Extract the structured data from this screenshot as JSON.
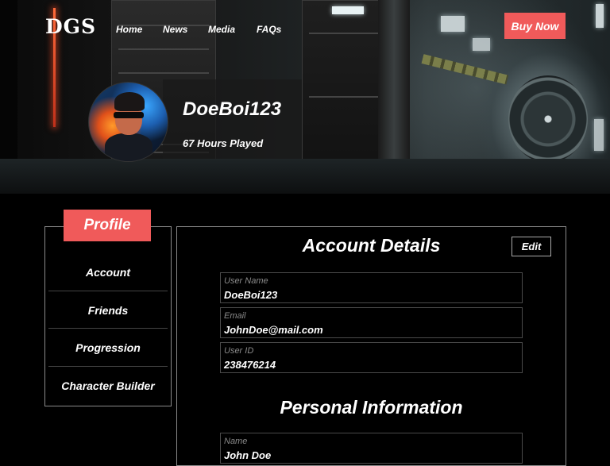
{
  "brand": {
    "logo": "DGS"
  },
  "nav": {
    "items": [
      "Home",
      "News",
      "Media",
      "FAQs"
    ],
    "cta": "Buy Now"
  },
  "profile": {
    "username": "DoeBoi123",
    "hours": "67 Hours Played"
  },
  "sidebar": {
    "tab": "Profile",
    "items": [
      "Account",
      "Friends",
      "Progression",
      "Character Builder"
    ]
  },
  "account": {
    "title": "Account Details",
    "edit_label": "Edit",
    "fields": [
      {
        "label": "User Name",
        "value": "DoeBoi123"
      },
      {
        "label": "Email",
        "value": "JohnDoe@mail.com"
      },
      {
        "label": "User ID",
        "value": "238476214"
      }
    ]
  },
  "personal": {
    "title": "Personal Information",
    "fields": [
      {
        "label": "Name",
        "value": "John Doe"
      }
    ]
  },
  "colors": {
    "accent": "#f05a5a",
    "border": "#8a8a8a",
    "background": "#000000"
  }
}
